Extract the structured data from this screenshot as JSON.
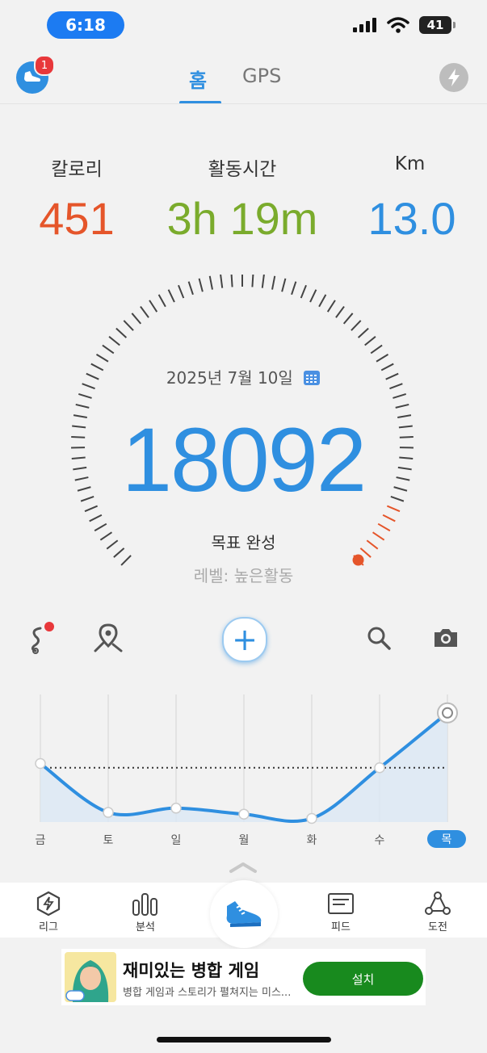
{
  "status_bar": {
    "time": "6:18",
    "battery": "41"
  },
  "header": {
    "tabs": [
      {
        "label": "홈",
        "active": true
      },
      {
        "label": "GPS",
        "active": false
      }
    ],
    "notification_count": "1",
    "left_icon": "shoe-icon",
    "right_icon": "lightning-icon"
  },
  "stats": [
    {
      "label": "칼로리",
      "value": "451",
      "color": "#e5552a"
    },
    {
      "label": "활동시간",
      "value": "3h 19m",
      "color": "#7aab2c"
    },
    {
      "label": "Km",
      "value": "13.0",
      "color": "#2f8fe0"
    }
  ],
  "gauge": {
    "date": "2025년 7월 10일",
    "steps": "18092",
    "goal_text": "목표 완성",
    "level_text": "레벨: 높은활동"
  },
  "toolbar": {
    "icons": [
      "route-icon",
      "map-pin-icon",
      "plus-icon",
      "search-icon",
      "camera-icon"
    ]
  },
  "chart_data": {
    "type": "line",
    "categories": [
      "금",
      "토",
      "일",
      "월",
      "화",
      "수",
      "목"
    ],
    "values": [
      9700,
      1600,
      2300,
      1300,
      600,
      9000,
      18092
    ],
    "goal_line": 9000,
    "ylim": [
      0,
      19000
    ],
    "active_category": "목"
  },
  "bottom_nav": [
    {
      "label": "리그",
      "icon": "lightning-hexagon-icon"
    },
    {
      "label": "분석",
      "icon": "bar-chart-icon"
    },
    {
      "label": "",
      "icon": "running-shoe-icon"
    },
    {
      "label": "피드",
      "icon": "feed-card-icon"
    },
    {
      "label": "도전",
      "icon": "challenge-network-icon"
    }
  ],
  "ad": {
    "title": "재미있는 병합 게임",
    "subtitle": "병합 게임과 스토리가 펼쳐지는 미스...",
    "button": "설치"
  },
  "colors": {
    "accent": "#2f8fe0",
    "calorie": "#e5552a",
    "time": "#7aab2c",
    "install": "#188a1e"
  }
}
